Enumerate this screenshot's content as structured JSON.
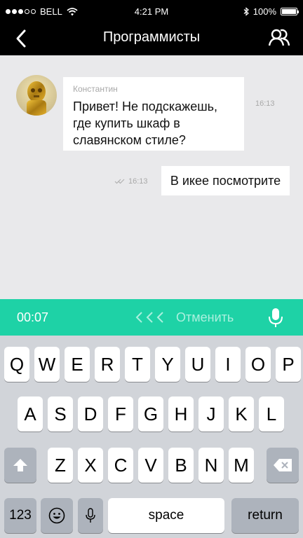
{
  "status_bar": {
    "carrier": "BELL",
    "time": "4:21 PM",
    "battery": "100%",
    "battery_level": 1.0,
    "signal_bars_filled": 3,
    "signal_bars_total": 5
  },
  "header": {
    "title": "Программисты",
    "back_icon": "chevron-left-icon",
    "members_icon": "people-icon"
  },
  "chat": {
    "messages": [
      {
        "author": "Константин",
        "text_lines": [
          "Привет! Не подскажешь,",
          "где купить шкаф в",
          "славянском стиле?"
        ],
        "time": "16:13"
      },
      {
        "text": "В икее посмотрите",
        "time": "16:13",
        "status_icon": "double-check-icon"
      }
    ]
  },
  "voice_recorder": {
    "timer": "00:07",
    "cancel_label": "Отменить",
    "accent_color": "#1ed2a6"
  },
  "keyboard": {
    "row1": [
      "Q",
      "W",
      "E",
      "R",
      "T",
      "Y",
      "U",
      "I",
      "O",
      "P"
    ],
    "row2": [
      "A",
      "S",
      "D",
      "F",
      "G",
      "H",
      "J",
      "K",
      "L"
    ],
    "row3": [
      "Z",
      "X",
      "C",
      "V",
      "B",
      "N",
      "M"
    ],
    "numbers_label": "123",
    "space_label": "space",
    "return_label": "return"
  }
}
